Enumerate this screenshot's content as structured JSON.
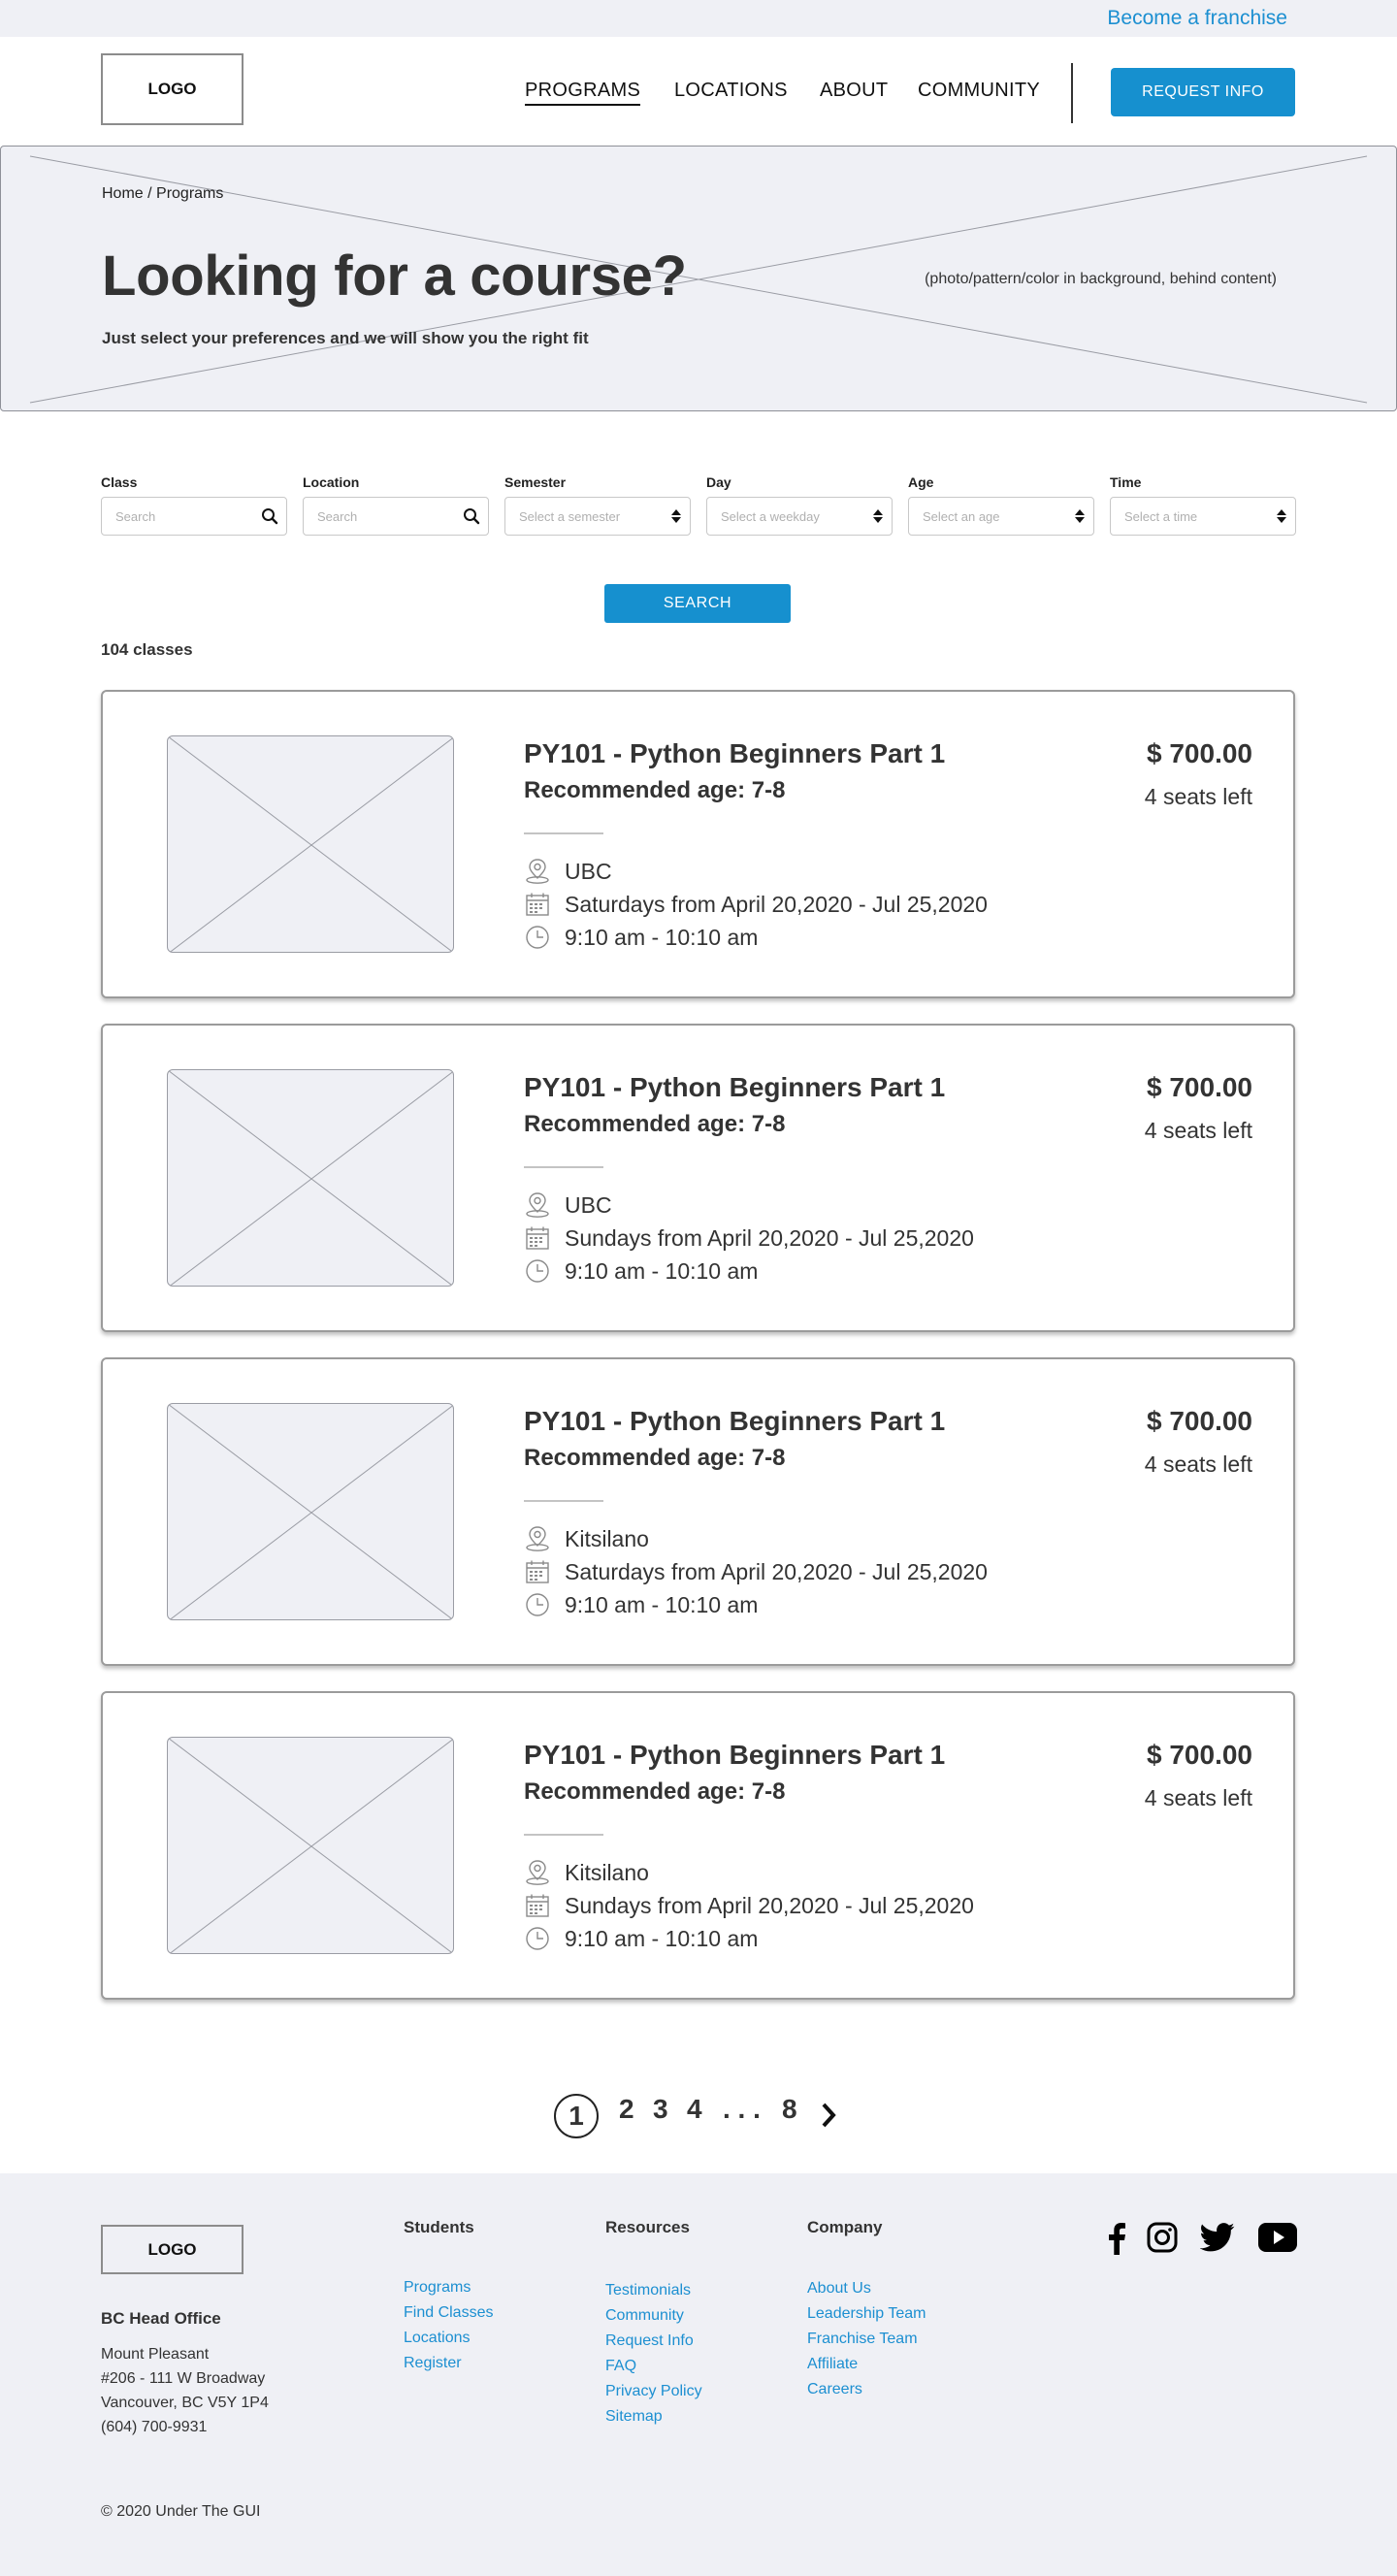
{
  "top_bar": {
    "franchise_link": "Become a franchise"
  },
  "header": {
    "logo": "LOGO",
    "nav": [
      "PROGRAMS",
      "LOCATIONS",
      "ABOUT",
      "COMMUNITY"
    ],
    "active_nav": "PROGRAMS",
    "request_button": "REQUEST INFO"
  },
  "hero": {
    "breadcrumb": "Home / Programs",
    "title": "Looking for a course?",
    "subtitle": "Just select your preferences and we will show you the right fit",
    "background_note": "(photo/pattern/color in background, behind content)"
  },
  "filters": [
    {
      "label": "Class",
      "placeholder": "Search",
      "icon": "search-icon"
    },
    {
      "label": "Location",
      "placeholder": "Search",
      "icon": "search-icon"
    },
    {
      "label": "Semester",
      "placeholder": "Select a semester",
      "icon": "sort-arrows-icon"
    },
    {
      "label": "Day",
      "placeholder": "Select a weekday",
      "icon": "sort-arrows-icon"
    },
    {
      "label": "Age",
      "placeholder": "Select an age",
      "icon": "sort-arrows-icon"
    },
    {
      "label": "Time",
      "placeholder": "Select a time",
      "icon": "sort-arrows-icon"
    }
  ],
  "search_button": "SEARCH",
  "class_count": "104 classes",
  "classes": [
    {
      "title": "PY101 - Python Beginners Part 1",
      "age": "Recommended age: 7-8",
      "location": "UBC",
      "schedule": "Saturdays from April 20,2020 - Jul 25,2020",
      "time": "9:10 am - 10:10 am",
      "price": "$ 700.00",
      "seats": "4 seats left"
    },
    {
      "title": "PY101 - Python Beginners Part 1",
      "age": "Recommended age: 7-8",
      "location": "UBC",
      "schedule": "Sundays from April 20,2020 - Jul 25,2020",
      "time": "9:10 am - 10:10 am",
      "price": "$ 700.00",
      "seats": "4 seats left"
    },
    {
      "title": "PY101 - Python Beginners Part 1",
      "age": "Recommended age: 7-8",
      "location": "Kitsilano",
      "schedule": "Saturdays from April 20,2020 - Jul 25,2020",
      "time": "9:10 am - 10:10 am",
      "price": "$ 700.00",
      "seats": "4 seats left"
    },
    {
      "title": "PY101 - Python Beginners Part 1",
      "age": "Recommended age: 7-8",
      "location": "Kitsilano",
      "schedule": "Sundays from April 20,2020 - Jul 25,2020",
      "time": "9:10 am - 10:10 am",
      "price": "$ 700.00",
      "seats": "4 seats left"
    }
  ],
  "pagination": {
    "current": "1",
    "pages": [
      "2",
      "3",
      "4"
    ],
    "ellipsis": ". . .",
    "last": "8",
    "next_icon": "chevron-right-icon"
  },
  "footer": {
    "logo": "LOGO",
    "office_title": "BC Head Office",
    "address": [
      "Mount Pleasant",
      "#206 - 111 W Broadway",
      "Vancouver, BC V5Y 1P4",
      "(604) 700-9931"
    ],
    "columns": [
      {
        "heading": "Students",
        "links": [
          "Programs",
          "Find Classes",
          "Locations",
          "Register"
        ]
      },
      {
        "heading": "Resources",
        "links": [
          "Testimonials",
          "Community",
          "Request Info",
          "FAQ",
          "Privacy Policy",
          "Sitemap"
        ]
      },
      {
        "heading": "Company",
        "links": [
          "About Us",
          "Leadership Team",
          "Franchise Team",
          "Affiliate",
          "Careers"
        ]
      }
    ],
    "social": [
      "facebook-icon",
      "instagram-icon",
      "twitter-icon",
      "youtube-icon"
    ],
    "copyright": "© 2020 Under The GUI"
  },
  "colors": {
    "accent": "#1690cf",
    "link": "#1c8fd1",
    "panel_bg": "#eff0f5",
    "text": "#333333"
  }
}
